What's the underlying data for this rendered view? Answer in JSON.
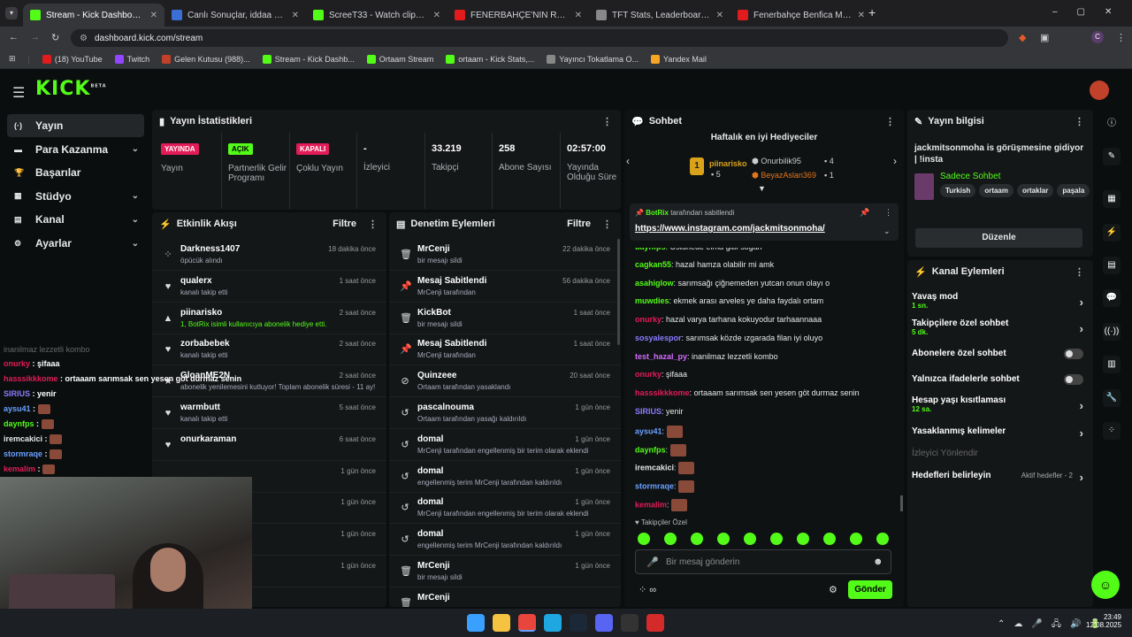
{
  "browser": {
    "tabs": [
      {
        "title": "Stream - Kick Dashboard",
        "color": "#53fc18"
      },
      {
        "title": "Canlı Sonuçlar, iddaa sonuçları",
        "color": "#3b6fd6"
      },
      {
        "title": "ScreeT33 - Watch clips on Kick",
        "color": "#53fc18"
      },
      {
        "title": "FENERBAHÇE'NİN RAKİBİ | Nic",
        "color": "#e21c1c"
      },
      {
        "title": "TFT Stats, Leaderboards, League",
        "color": "#888888"
      },
      {
        "title": "Fenerbahçe Benfica Maç Özeti",
        "color": "#e21c1c"
      }
    ],
    "url": "dashboard.kick.com/stream",
    "bookmarks": [
      "(18) YouTube",
      "Twitch",
      "Gelen Kutusu (988)...",
      "Stream - Kick Dashb...",
      "Ortaam Stream",
      "ortaam - Kick Stats,...",
      "Yayıncı Tokatlama O...",
      "Yandex Mail"
    ]
  },
  "kick": {
    "logo": "KICK",
    "beta": "BETA"
  },
  "sidebar": {
    "items": [
      {
        "label": "Yayın",
        "icon": "stream-icon"
      },
      {
        "label": "Para Kazanma",
        "icon": "money-icon"
      },
      {
        "label": "Başarılar",
        "icon": "trophy-icon"
      },
      {
        "label": "Stüdyo",
        "icon": "studio-icon"
      },
      {
        "label": "Kanal",
        "icon": "channel-icon"
      },
      {
        "label": "Ayarlar",
        "icon": "settings-icon"
      }
    ]
  },
  "stats": {
    "title": "Yayın İstatistikleri",
    "items": [
      {
        "badge": "YAYINDA",
        "label": "Yayın",
        "color": "#e21c58"
      },
      {
        "badge": "AÇIK",
        "label": "Partnerlik Gelir Programı",
        "color": "#53fc18"
      },
      {
        "badge": "KAPALI",
        "label": "Çoklu Yayın",
        "color": "#e21c58"
      },
      {
        "value": "-",
        "label": "İzleyici"
      },
      {
        "value": "33.219",
        "label": "Takipçi"
      },
      {
        "value": "258",
        "label": "Abone Sayısı"
      },
      {
        "value": "02:57:00",
        "label": "Yayında Olduğu Süre"
      }
    ]
  },
  "activity": {
    "title": "Etkinlik Akışı",
    "filter": "Filtre",
    "rows": [
      {
        "name": "Darkness1407",
        "sub": "öpücük alındı",
        "time": "18 dakika önce"
      },
      {
        "name": "qualerx",
        "sub": "kanalı takip etti",
        "time": "1 saat önce"
      },
      {
        "name": "piinarisko",
        "sub": "1, BotRix isimli kullanıcıya abonelik hediye etti.",
        "time": "2 saat önce"
      },
      {
        "name": "zorbabebek",
        "sub": "kanalı takip etti",
        "time": "2 saat önce"
      },
      {
        "name": "GloanME2N",
        "sub": "abonelik yenilemesini kutluyor! Toplam abonelik süresi - 11 ay!",
        "time": "2 saat önce"
      },
      {
        "name": "warmbutt",
        "sub": "kanalı takip etti",
        "time": "5 saat önce"
      },
      {
        "name": "onurkaraman",
        "sub": "",
        "time": "6 saat önce"
      },
      {
        "name": "",
        "sub": "",
        "time": "1 gün önce"
      },
      {
        "name": "n abone oldu!",
        "sub": "",
        "time": "1 gün önce"
      },
      {
        "name": "den abone oldu!",
        "sub": "",
        "time": "1 gün önce"
      },
      {
        "name": "iden abone oldu!",
        "sub": "",
        "time": "1 gün önce"
      }
    ]
  },
  "moderation": {
    "title": "Denetim Eylemleri",
    "filter": "Filtre",
    "rows": [
      {
        "name": "MrCenji",
        "sub": "bir mesajı sildi",
        "time": "22 dakika önce",
        "icon": "trash-icon"
      },
      {
        "name": "Mesaj Sabitlendi",
        "sub": "MrCenji tarafından",
        "time": "56 dakika önce",
        "icon": "pin-icon"
      },
      {
        "name": "KickBot",
        "sub": "bir mesajı sildi",
        "time": "1 saat önce",
        "icon": "trash-icon"
      },
      {
        "name": "Mesaj Sabitlendi",
        "sub": "MrCenji tarafından",
        "time": "1 saat önce",
        "icon": "pin-icon"
      },
      {
        "name": "Quinzeee",
        "sub": "Ortaam tarafından yasaklandı",
        "time": "20 saat önce",
        "icon": "ban-icon"
      },
      {
        "name": "pascalnouma",
        "sub": "Ortaam tarafından yasağı kaldırıldı",
        "time": "1 gün önce",
        "icon": "undo-icon"
      },
      {
        "name": "domal",
        "sub": "MrCenji tarafından engellenmiş bir terim olarak eklendi",
        "time": "1 gün önce",
        "icon": "undo-icon"
      },
      {
        "name": "domal",
        "sub": "engellenmiş terim MrCenji tarafından kaldırıldı",
        "time": "1 gün önce",
        "icon": "undo-icon"
      },
      {
        "name": "domal",
        "sub": "MrCenji tarafından engellenmiş bir terim olarak eklendi",
        "time": "1 gün önce",
        "icon": "undo-icon"
      },
      {
        "name": "domal",
        "sub": "engellenmiş terim MrCenji tarafından kaldırıldı",
        "time": "1 gün önce",
        "icon": "undo-icon"
      },
      {
        "name": "MrCenji",
        "sub": "bir mesajı sildi",
        "time": "1 gün önce",
        "icon": "trash-icon"
      },
      {
        "name": "MrCenji",
        "sub": "",
        "time": "",
        "icon": "trash-icon"
      }
    ]
  },
  "chat": {
    "title": "Sohbet",
    "gifters_title": "Haftalık en iyi Hediyeciler",
    "gifters": [
      {
        "rank": "1",
        "name": "piinarisko",
        "count": "5"
      },
      {
        "name": "Onurbilik95",
        "count": "4"
      },
      {
        "name": "BeyazAslan369",
        "count": "1"
      }
    ],
    "pinned_by": "BotRix",
    "pinned_suffix": "tarafından sabitlendi",
    "pinned_link": "https://www.instagram.com/jackmitsonmoha/",
    "messages": [
      {
        "user": "daynfps",
        "text": "Üstünede elma gibi soğan",
        "color": "#53fc18"
      },
      {
        "user": "cagkan55",
        "text": "hazal hamza olabilir mi amk",
        "color": "#53fc18"
      },
      {
        "user": "asahiglow",
        "text": "sarımsağı çiğnemeden yutcan onun olayı o",
        "color": "#53fc18"
      },
      {
        "user": "muwdies",
        "text": "ekmek arası arveles ye daha faydalı ortam",
        "color": "#53fc18"
      },
      {
        "user": "onurky",
        "text": "hazal varya tarhana kokuyodur tarhaannaaa",
        "color": "#e21c58"
      },
      {
        "user": "sosyalespor",
        "text": "sarımsak közde ızgarada filan iyi oluyo",
        "color": "#8a7bff"
      },
      {
        "user": "test_hazal_py",
        "text": "inanilmaz lezzetli kombo",
        "color": "#d46bff"
      },
      {
        "user": "onurky",
        "text": "şifaaa",
        "color": "#e21c58"
      },
      {
        "user": "hasssikkkome",
        "text": "ortaaam sarımsak sen yesen göt durmaz senin",
        "color": "#e21c58"
      },
      {
        "user": "SIRIUS",
        "text": "yenir",
        "color": "#8a7bff"
      },
      {
        "user": "aysu41",
        "text": "",
        "color": "#6aa0ff"
      },
      {
        "user": "daynfps",
        "text": "",
        "color": "#53fc18"
      },
      {
        "user": "iremcakici",
        "text": "",
        "color": "#e6e8ea"
      },
      {
        "user": "stormraqe",
        "text": "",
        "color": "#6aa0ff"
      },
      {
        "user": "kemalim",
        "text": "",
        "color": "#e21c58"
      }
    ],
    "followers_only": "Takipçiler Özel",
    "placeholder": "Bir mesaj gönderin",
    "send": "Gönder"
  },
  "info": {
    "title": "Yayın bilgisi",
    "stream_title": "jackmitsonmoha is görüşmesine gidiyor | !insta",
    "category": "Sadece Sohbet",
    "tags": [
      "Turkish",
      "ortaam",
      "ortaklar",
      "paşala"
    ],
    "edit": "Düzenle"
  },
  "channel_actions": {
    "title": "Kanal Eylemleri",
    "items": [
      {
        "label": "Yavaş mod",
        "sub": "1 sn.",
        "type": "arrow"
      },
      {
        "label": "Takipçilere özel sohbet",
        "sub": "5 dk.",
        "type": "arrow"
      },
      {
        "label": "Abonelere özel sohbet",
        "sub": "",
        "type": "toggle"
      },
      {
        "label": "Yalnızca ifadelerle sohbet",
        "sub": "",
        "type": "toggle"
      },
      {
        "label": "Hesap yaşı kısıtlaması",
        "sub": "12 sa.",
        "type": "arrow"
      },
      {
        "label": "Yasaklanmış kelimeler",
        "sub": "",
        "type": "arrow"
      },
      {
        "label": "İzleyici Yönlendir",
        "sub": "",
        "type": "none"
      },
      {
        "label": "Hedefleri belirleyin",
        "sub": "",
        "type": "arrow"
      }
    ],
    "goals_status": "Aktif hedefler - 2"
  },
  "overlay": {
    "lines": [
      {
        "user": "onurky",
        "text": "şifaaa",
        "color": "#e21c58"
      },
      {
        "user": "hasssikkkome",
        "text": "ortaaam sarımsak sen yesen göt durmaz senin",
        "color": "#e21c58"
      },
      {
        "user": "SIRIUS",
        "text": "yenir",
        "color": "#8a7bff"
      },
      {
        "user": "aysu41",
        "text": "",
        "color": "#6aa0ff"
      },
      {
        "user": "daynfps",
        "text": "",
        "color": "#53fc18"
      },
      {
        "user": "iremcakici",
        "text": "",
        "color": "#e6e8ea"
      },
      {
        "user": "stormraqe",
        "text": "",
        "color": "#6aa0ff"
      },
      {
        "user": "kemalim",
        "text": "",
        "color": "#e21c58"
      }
    ],
    "faded": "inanilmaz lezzetli kombo"
  },
  "clock": {
    "time": "23:49",
    "date": "12.08.2025"
  }
}
